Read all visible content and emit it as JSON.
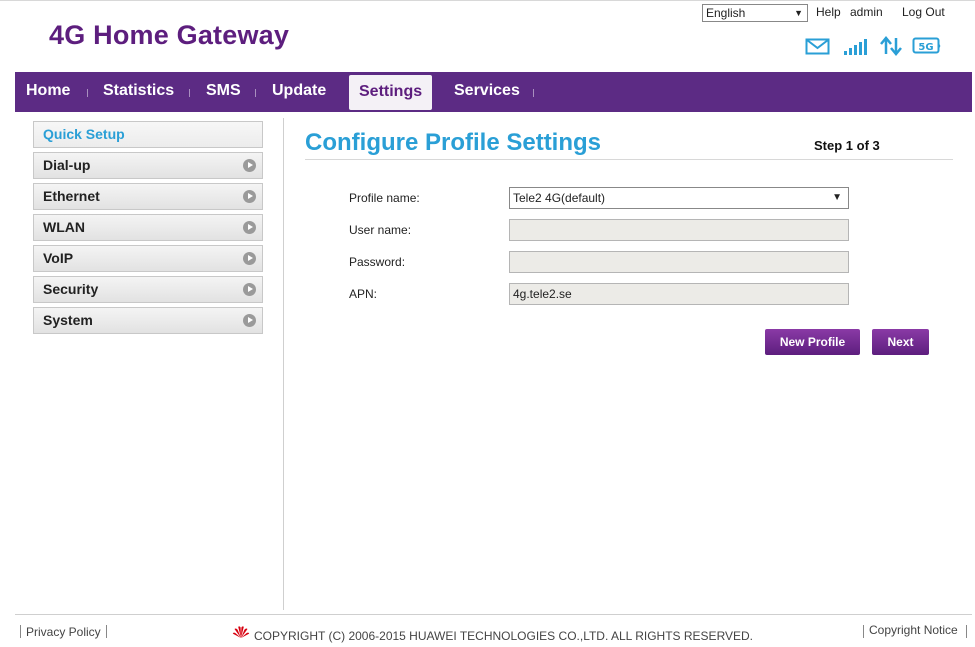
{
  "header": {
    "title": "4G Home Gateway",
    "language": "English",
    "links": {
      "help": "Help",
      "user": "admin",
      "logout": "Log Out"
    }
  },
  "nav": {
    "items": [
      "Home",
      "Statistics",
      "SMS",
      "Update",
      "Settings",
      "Services"
    ],
    "active": "Settings"
  },
  "sidebar": {
    "items": [
      "Quick Setup",
      "Dial-up",
      "Ethernet",
      "WLAN",
      "VoIP",
      "Security",
      "System"
    ],
    "active": "Quick Setup"
  },
  "main": {
    "title": "Configure Profile Settings",
    "step": "Step 1 of 3",
    "fields": {
      "profile_name": {
        "label": "Profile name:",
        "value": "Tele2 4G(default)"
      },
      "user_name": {
        "label": "User name:",
        "value": ""
      },
      "password": {
        "label": "Password:",
        "value": ""
      },
      "apn": {
        "label": "APN:",
        "value": "4g.tele2.se"
      }
    },
    "buttons": {
      "new_profile": "New Profile",
      "next": "Next"
    }
  },
  "footer": {
    "privacy": "Privacy Policy",
    "copyright": "COPYRIGHT (C) 2006-2015 HUAWEI TECHNOLOGIES CO.,LTD. ALL RIGHTS RESERVED.",
    "notice": "Copyright Notice"
  },
  "colors": {
    "brand_purple": "#5d1e7e",
    "nav_purple": "#5c2b84",
    "accent_blue": "#2a9fd6"
  },
  "icons": [
    "mail-icon",
    "signal-icon",
    "data-transfer-icon",
    "5g-icon",
    "huawei-logo-icon",
    "chevron-right-icon"
  ]
}
